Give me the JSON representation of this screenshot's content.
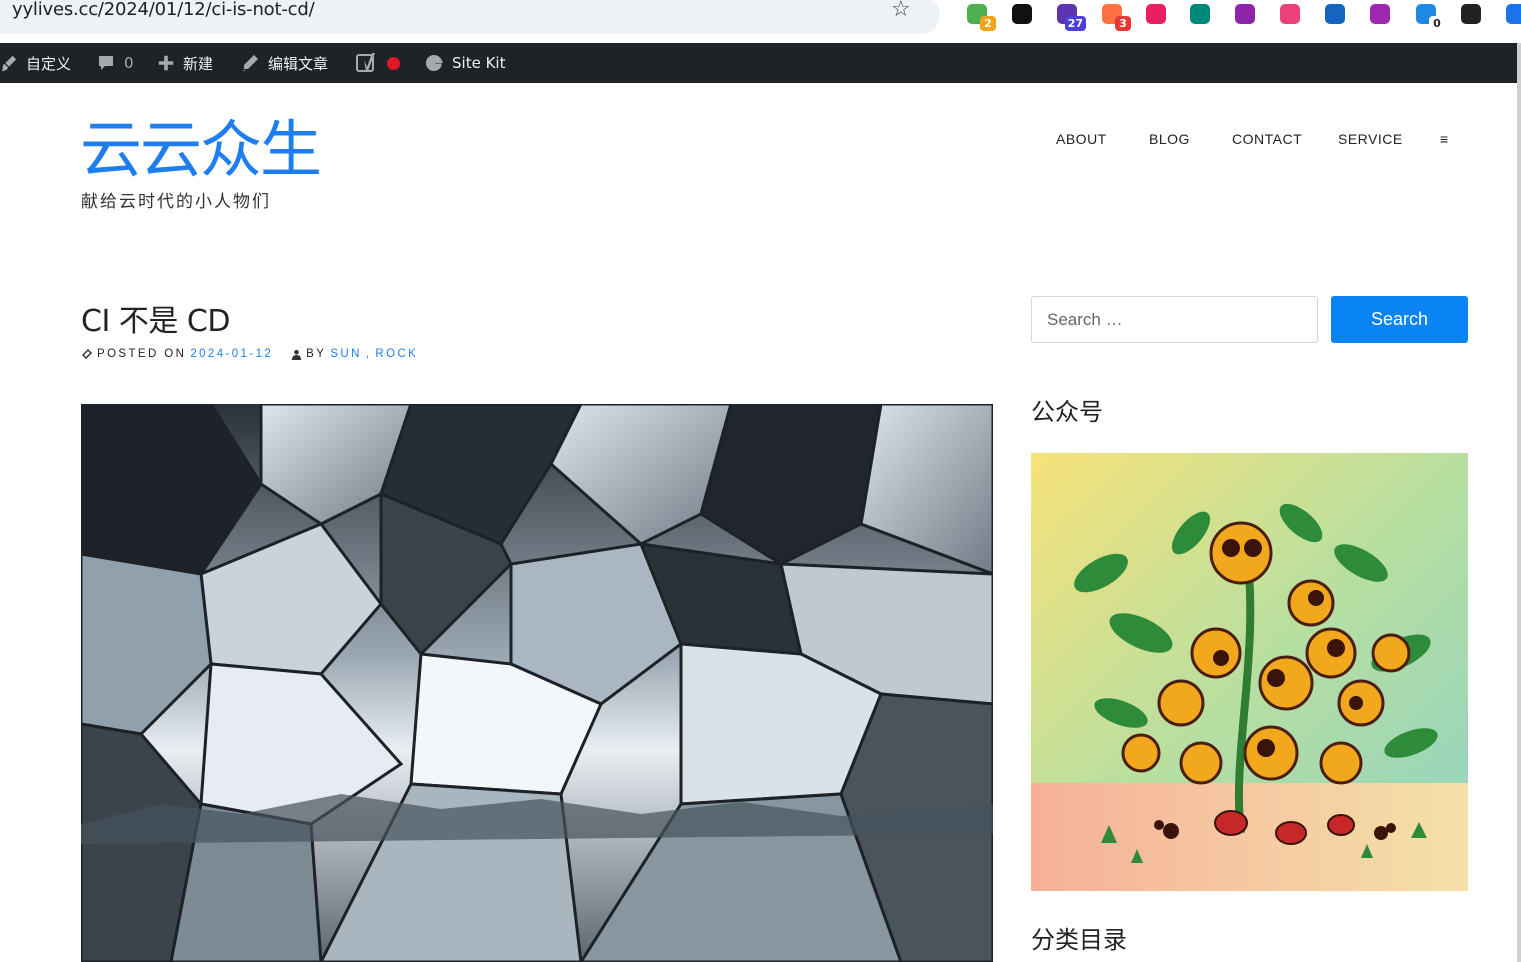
{
  "browser": {
    "url": "yylives.cc/2024/01/12/ci-is-not-cd/",
    "omnibox_leading_char": "s",
    "extensions": [
      {
        "name": "extension-1-icon",
        "color": "#4caf50",
        "badge": "2",
        "badge_color": "#f0a21b"
      },
      {
        "name": "notion-icon",
        "color": "#111111",
        "badge": ""
      },
      {
        "name": "extension-3-icon",
        "color": "#5e35b1",
        "badge": "27",
        "badge_color": "#4b3fd6"
      },
      {
        "name": "extension-4-icon",
        "color": "#ff7043",
        "badge": "3",
        "badge_color": "#e53935"
      },
      {
        "name": "translate-icon",
        "color": "#e91e63",
        "badge": ""
      },
      {
        "name": "extension-6-icon",
        "color": "#00897b",
        "badge": ""
      },
      {
        "name": "extension-7-icon",
        "color": "#8e24aa",
        "badge": ""
      },
      {
        "name": "extension-8-icon",
        "color": "#ec407a",
        "badge": ""
      },
      {
        "name": "extension-9-icon",
        "color": "#1565c0",
        "badge": ""
      },
      {
        "name": "openai-icon",
        "color": "#9c27b0",
        "badge": ""
      },
      {
        "name": "extension-11-icon",
        "color": "#1e88e5",
        "badge": "0",
        "badge_color": "#ffffff"
      },
      {
        "name": "extension-12-icon",
        "color": "#222222",
        "badge": ""
      },
      {
        "name": "extension-13-icon",
        "color": "#1a73e8",
        "badge": ""
      }
    ]
  },
  "adminbar": {
    "customize": "自定义",
    "comments_count": "0",
    "new": "新建",
    "edit_post": "编辑文章",
    "sitekit": "Site Kit"
  },
  "site": {
    "title": "云云众生",
    "description": "献给云时代的小人物们",
    "nav": [
      "ABOUT",
      "BLOG",
      "CONTACT",
      "SERVICE",
      "≡"
    ]
  },
  "post": {
    "title": "CI 不是 CD",
    "posted_on_label": "POSTED ON",
    "date": "2024-01-12",
    "by_label": "BY",
    "authors": [
      "SUN",
      "ROCK"
    ],
    "author_separator": ","
  },
  "sidebar": {
    "search_placeholder": "Search …",
    "search_button": "Search",
    "widget1_title": "公众号",
    "widget2_title": "分类目录"
  },
  "colors": {
    "accent": "#1e7ef0",
    "button": "#0a84f5",
    "adminbar": "#1d2327"
  }
}
